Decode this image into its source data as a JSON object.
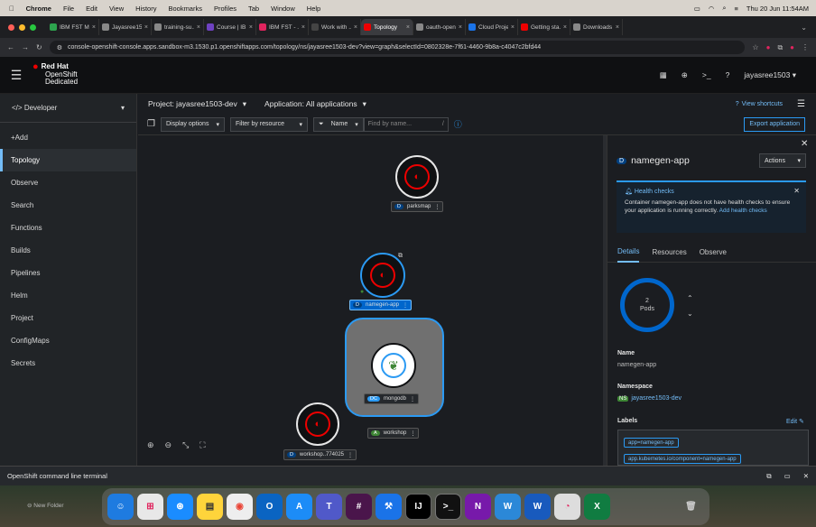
{
  "menubar": {
    "app": "Chrome",
    "items": [
      "File",
      "Edit",
      "View",
      "History",
      "Bookmarks",
      "Profiles",
      "Tab",
      "Window",
      "Help"
    ],
    "clock": "Thu 20 Jun  11:54AM"
  },
  "tabs": [
    {
      "label": "IBM FST M...",
      "color": "#2da44e"
    },
    {
      "label": "Jayasree15...",
      "color": "#888888"
    },
    {
      "label": "training-su...",
      "color": "#888888"
    },
    {
      "label": "Course | IB...",
      "color": "#6f42c1"
    },
    {
      "label": "IBM FST - ...",
      "color": "#e0245e"
    },
    {
      "label": "Work with ...",
      "color": "#444444"
    },
    {
      "label": "Topology",
      "color": "#ee0000"
    },
    {
      "label": "oauth-open...",
      "color": "#888888"
    },
    {
      "label": "Cloud Proje...",
      "color": "#1a73e8"
    },
    {
      "label": "Getting sta...",
      "color": "#ee0000"
    },
    {
      "label": "Downloads",
      "color": "#888888"
    }
  ],
  "address": {
    "url": "console-openshift-console.apps.sandbox-m3.1530.p1.openshiftapps.com/topology/ns/jayasree1503-dev?view=graph&selectId=0802328e-7f61-4460-9b8a-c4047c2bfd44"
  },
  "masthead": {
    "brand_line1": "Red Hat",
    "brand_line2": "OpenShift",
    "brand_line3": "Dedicated",
    "user": "jayasree1503 ▾"
  },
  "sidebar": {
    "perspective": "Developer",
    "items": [
      {
        "label": "+Add"
      },
      {
        "label": "Topology"
      },
      {
        "label": "Observe"
      },
      {
        "label": "Search"
      },
      {
        "label": "Functions"
      },
      {
        "label": "Builds"
      },
      {
        "label": "Pipelines"
      },
      {
        "label": "Helm"
      },
      {
        "label": "Project"
      },
      {
        "label": "ConfigMaps"
      },
      {
        "label": "Secrets"
      }
    ]
  },
  "project_bar": {
    "project": "Project: jayasree1503-dev",
    "application": "Application: All applications"
  },
  "toolbar": {
    "display_options": "Display options",
    "filter_by_resource": "Filter by resource",
    "name_filter": "Name",
    "find_placeholder": "Find by name...",
    "shortcut": "/",
    "view_shortcuts": "View shortcuts",
    "export": "Export application"
  },
  "topology": {
    "nodes": [
      {
        "kind": "D",
        "name": "parksmap"
      },
      {
        "kind": "D",
        "name": "namegen-app"
      },
      {
        "kind": "DC",
        "name": "mongodb"
      },
      {
        "kind": "D",
        "name": "workshop..774025"
      }
    ],
    "group": {
      "kind": "A",
      "name": "workshop"
    }
  },
  "panel": {
    "kind": "D",
    "title": "namegen-app",
    "actions": "Actions",
    "alert_title": "Health checks",
    "alert_body": "Container namegen-app does not have health checks to ensure your application is running correctly.",
    "alert_link": "Add health checks",
    "tabs": [
      "Details",
      "Resources",
      "Observe"
    ],
    "pods_count": "2",
    "pods_label": "Pods",
    "name_label": "Name",
    "name_value": "namegen-app",
    "namespace_label": "Namespace",
    "namespace_badge": "NS",
    "namespace_value": "jayasree1503-dev",
    "labels_label": "Labels",
    "edit": "Edit",
    "labels": [
      "app=namegen-app",
      "app.kubernetes.io/component=namegen-app"
    ]
  },
  "terminal": {
    "title": "OpenShift command line terminal"
  },
  "desktop": {
    "folder": "New Folder"
  }
}
